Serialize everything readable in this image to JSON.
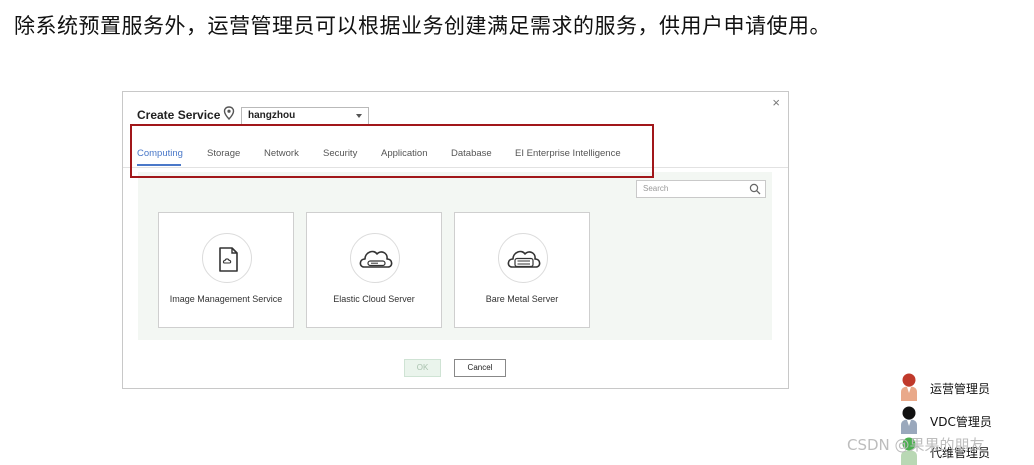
{
  "headline": "除系统预置服务外，运营管理员可以根据业务创建满足需求的服务，供用户申请使用。",
  "dialog": {
    "title": "Create Service",
    "region_value": "hangzhou",
    "close_glyph": "×",
    "tabs": [
      {
        "label": "Computing",
        "active": true
      },
      {
        "label": "Storage",
        "active": false
      },
      {
        "label": "Network",
        "active": false
      },
      {
        "label": "Security",
        "active": false
      },
      {
        "label": "Application",
        "active": false
      },
      {
        "label": "Database",
        "active": false
      },
      {
        "label": "EI Enterprise Intelligence",
        "active": false
      }
    ],
    "search_placeholder": "Search",
    "services": [
      {
        "label": "Image Management Service",
        "icon": "image-file-icon"
      },
      {
        "label": "Elastic Cloud Server",
        "icon": "cloud-server-icon"
      },
      {
        "label": "Bare Metal Server",
        "icon": "bare-metal-server-icon"
      }
    ],
    "ok_label": "OK",
    "cancel_label": "Cancel"
  },
  "legend": [
    {
      "label": "运营管理员",
      "color": "#c0392b"
    },
    {
      "label": "VDC管理员",
      "color": "#111111"
    },
    {
      "label": "代维管理员",
      "color": "#4caf50"
    }
  ],
  "watermark": "CSDN @果果的朋友",
  "colors": {
    "accent": "#4a78c8",
    "highlight_border": "#a1171a",
    "content_bg": "#f3f7f3"
  }
}
